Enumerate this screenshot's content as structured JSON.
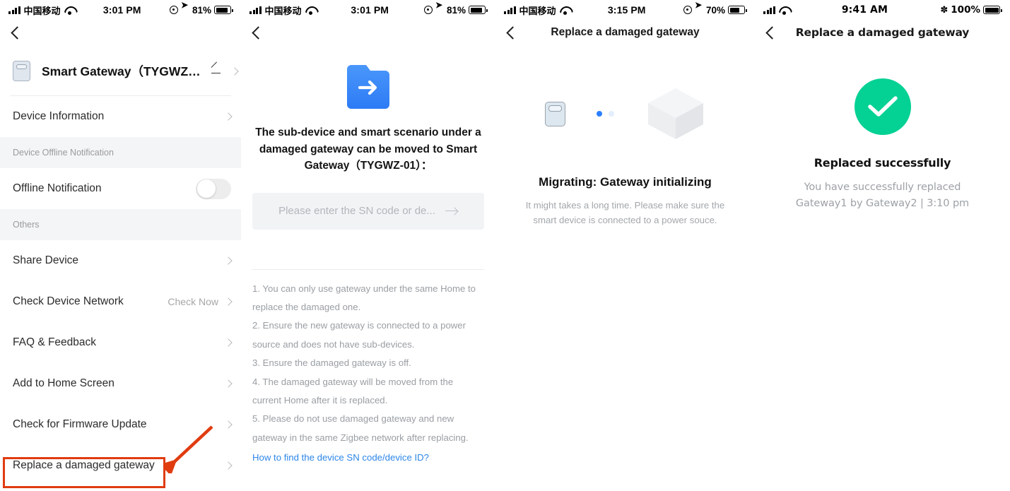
{
  "panel1": {
    "status": {
      "carrier": "中国移动",
      "time": "3:01 PM",
      "battery": "81%"
    },
    "device": {
      "name": "Smart Gateway（TYGWZ…"
    },
    "rows": [
      {
        "label": "Device Information",
        "aux": ""
      }
    ],
    "group_offline": "Device Offline Notification",
    "offline_toggle_label": "Offline Notification",
    "group_others": "Others",
    "others_rows": [
      {
        "label": "Share Device",
        "aux": ""
      },
      {
        "label": "Check Device Network",
        "aux": "Check Now"
      },
      {
        "label": "FAQ & Feedback",
        "aux": ""
      },
      {
        "label": "Add to Home Screen",
        "aux": ""
      },
      {
        "label": "Check for Firmware Update",
        "aux": ""
      },
      {
        "label": "Replace a damaged gateway",
        "aux": ""
      }
    ],
    "annotation_color": "#e03c10"
  },
  "panel2": {
    "status": {
      "carrier": "中国移动",
      "time": "3:01 PM",
      "battery": "81%"
    },
    "title": "The sub-device and smart scenario under a damaged gateway can be moved to Smart Gateway（TYGWZ-01）：",
    "sn_input": {
      "placeholder": "Please enter the SN code or de...",
      "value": ""
    },
    "notes": [
      "1. You can only use gateway under the same Home to replace the damaged one.",
      "2. Ensure the new gateway is connected to a power source and does not have sub-devices.",
      "3. Ensure the damaged gateway is off.",
      "4. The damaged gateway will be moved from the current Home after it is replaced.",
      "5. Please do not use damaged gateway and new gateway in the same Zigbee network after replacing."
    ],
    "link": "How to find the device SN code/device ID?",
    "accent_color": "#3b8df8",
    "link_color": "#2d86e8"
  },
  "panel3": {
    "status": {
      "carrier": "中国移动",
      "time": "3:15 PM",
      "battery": "70%"
    },
    "nav_title": "Replace a damaged gateway",
    "title": "Migrating: Gateway initializing",
    "subtitle": "It might takes a long time. Please make sure the smart device is connected to a power souce.",
    "dot_active_color": "#2b7fff"
  },
  "panel4": {
    "status": {
      "time": "9:41 AM",
      "battery": "100%"
    },
    "nav_title": "Replace a damaged gateway",
    "title": "Replaced successfully",
    "subtitle": "You have successfully replaced Gateway1 by Gateway2 | 3:10 pm",
    "success_color": "#04d194"
  }
}
